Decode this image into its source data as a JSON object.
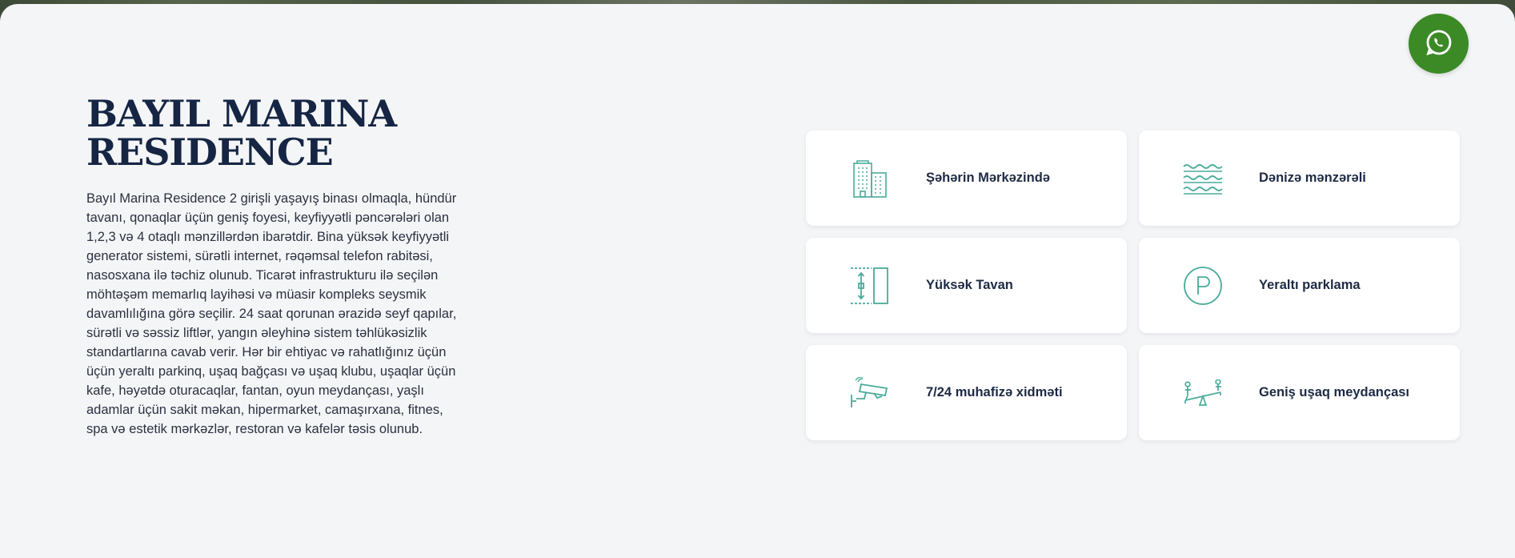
{
  "title": "BAYIL MARINA RESIDENCE",
  "description": "Bayıl Marina Residence 2 girişli yaşayış binası olmaqla, hündür tavanı, qonaqlar üçün geniş foyesi, keyfiyyətli pəncərələri olan 1,2,3 və 4 otaqlı mənzillərdən ibarətdir. Bina yüksək keyfiyyətli generator sistemi, sürətli internet, rəqəmsal telefon rabitəsi, nasosxana ilə təchiz olunub. Ticarət infrastrukturu ilə seçilən möhtəşəm memarlıq layihəsi və müasir kompleks seysmik davamlılığına görə seçilir. 24 saat qorunan ərazidə seyf qapılar, sürətli və səssiz liftlər, yangın əleyhinə sistem təhlükəsizlik standartlarına cavab verir. Hər bir ehtiyac və rahatlığınız üçün üçün yeraltı parkinq, uşaq bağçası və uşaq klubu, uşaqlar üçün kafe, həyətdə oturacaqlar, fantan, oyun meydançası, yaşlı adamlar üçün sakit məkan, hipermarket, camaşırxana, fitnes, spa və estetik mərkəzlər, restoran və kafelər təsis olunub.",
  "features": [
    {
      "label": "Şəhərin Mərkəzində",
      "icon": "building-icon"
    },
    {
      "label": "Dənizə mənzərəli",
      "icon": "waves-icon"
    },
    {
      "label": "Yüksək Tavan",
      "icon": "ceiling-height-icon"
    },
    {
      "label": "Yeraltı parklama",
      "icon": "parking-icon"
    },
    {
      "label": "7/24 muhafizə xidməti",
      "icon": "security-camera-icon"
    },
    {
      "label": "Geniş uşaq meydançası",
      "icon": "playground-icon"
    }
  ],
  "colors": {
    "accent": "#4aab9a",
    "title": "#152543",
    "whatsapp": "#3b8a26",
    "background": "#f4f5f7"
  }
}
